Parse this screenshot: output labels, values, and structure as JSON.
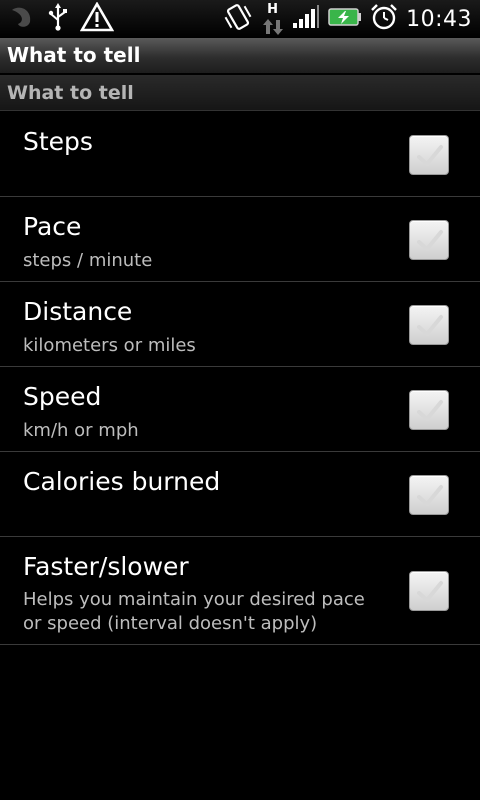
{
  "status_bar": {
    "time": "10:43",
    "network_type": "H",
    "icons": [
      "app-icon",
      "usb-icon",
      "warning-icon",
      "vibrate-icon",
      "data-transfer-icon",
      "signal-icon",
      "battery-charging-icon",
      "alarm-icon"
    ]
  },
  "titlebar": {
    "title": "What to tell"
  },
  "category": {
    "label": "What to tell"
  },
  "preferences": [
    {
      "title": "Steps",
      "summary": "",
      "checked": false
    },
    {
      "title": "Pace",
      "summary": "steps / minute",
      "checked": false
    },
    {
      "title": "Distance",
      "summary": "kilometers or miles",
      "checked": false
    },
    {
      "title": "Speed",
      "summary": "km/h or mph",
      "checked": false
    },
    {
      "title": "Calories burned",
      "summary": "",
      "checked": false
    },
    {
      "title": "Faster/slower",
      "summary": "Helps you maintain your desired pace or speed (interval doesn't apply)",
      "checked": false
    }
  ],
  "colors": {
    "background": "#000000",
    "battery": "#3ab54a",
    "summary_text": "#bdbdbd"
  }
}
